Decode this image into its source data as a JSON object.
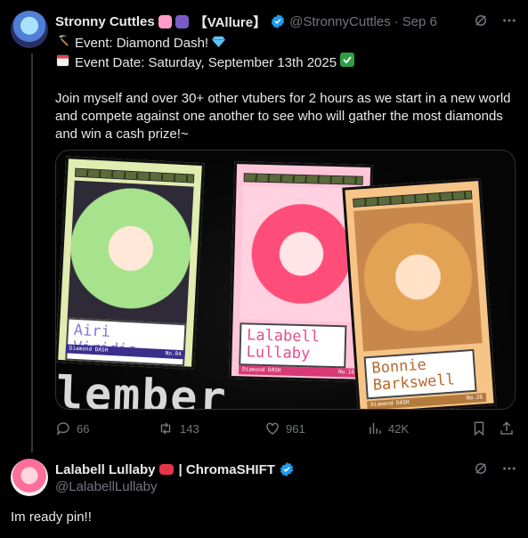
{
  "tweet": {
    "name": "Stronny Cuttles",
    "name_suffix": "【VAllure】",
    "handle": "@StronnyCuttles",
    "separator": "·",
    "date": "Sep 6",
    "lines": [
      "Event: Diamond Dash!",
      "Event Date: Saturday, September 13th 2025"
    ],
    "paragraph": "Join myself and over 30+ other vtubers for 2 hours as we start in a new world and compete against one another to see who will gather the most diamonds and win a cash prize!~",
    "media": {
      "cards": [
        {
          "name": "Airi Viridis",
          "footer_left": "Diamond DASH",
          "footer_right": "No.84"
        },
        {
          "name": "Lalabell Lullaby",
          "footer_left": "Diamond DASH",
          "footer_right": "No.16"
        },
        {
          "name": "Bonnie Barkswell",
          "footer_left": "Diamond DASH",
          "footer_right": "No.26"
        }
      ],
      "background_text": "lember"
    },
    "actions": {
      "replies": "66",
      "reposts": "143",
      "likes": "961",
      "views": "42K"
    }
  },
  "reply": {
    "name": "Lalabell Lullaby",
    "name_suffix": "| ChromaSHIFT",
    "handle": "@LalabellLullaby",
    "text": "Im ready pin!!"
  },
  "icons": {
    "line1": "pickaxe-icon",
    "line1_end": "gem-icon",
    "line2": "calendar-icon",
    "line2_end": "check-mark-icon"
  },
  "colors": {
    "background": "#000000",
    "text": "#e7e9ea",
    "muted": "#71767b",
    "verified": "#1d9bf0",
    "check": "#2ea043"
  }
}
